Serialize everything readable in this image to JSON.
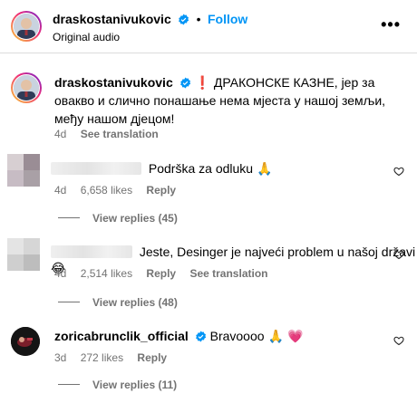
{
  "header": {
    "username": "draskostanivukovic",
    "separator": "•",
    "follow_label": "Follow",
    "subtitle": "Original audio",
    "more_label": "•••"
  },
  "caption": {
    "username": "draskostanivukovic",
    "alert": "❗",
    "text": "ДРАКОНСКЕ КАЗНЕ, јер за овакво и слично понашање нема мјеста у нашој земљи, међу нашом дјецом!",
    "time": "4d",
    "translate_label": "See translation"
  },
  "comments": [
    {
      "text": "Podrška za odluku",
      "emoji": "🙏",
      "time": "4d",
      "likes": "6,658 likes",
      "reply_label": "Reply",
      "view_replies": "View replies (45)"
    },
    {
      "text": "Jeste, Desinger je najveći problem u našoj državi",
      "emoji": "😂",
      "time": "4d",
      "likes": "2,514 likes",
      "reply_label": "Reply",
      "translate_label": "See translation",
      "view_replies": "View replies (48)"
    },
    {
      "username": "zoricabrunclik_official",
      "text": "Bravoooo",
      "emoji": "🙏 💗",
      "time": "3d",
      "likes": "272 likes",
      "reply_label": "Reply",
      "view_replies": "View replies (11)"
    }
  ],
  "colors": {
    "link": "#0095f6",
    "meta": "#737373",
    "verified": "#0095f6"
  },
  "icons": [
    "verified-badge-icon",
    "more-options-icon",
    "heart-icon"
  ]
}
